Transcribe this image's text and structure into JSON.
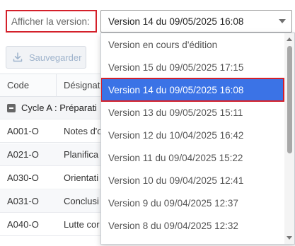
{
  "version_selector": {
    "label": "Afficher la version:",
    "selected_value": "Version 14 du 09/05/2025 16:08",
    "options": [
      "Version en cours d'édition",
      "Version 15 du 09/05/2025 17:15",
      "Version 14 du 09/05/2025 16:08",
      "Version 13 du 09/05/2025 15:11",
      "Version 12 du 10/04/2025 16:42",
      "Version 11 du 09/04/2025 15:22",
      "Version 10 du 09/04/2025 12:41",
      "Version 9 du 09/04/2025 12:37",
      "Version 8 du 09/04/2025 12:32"
    ]
  },
  "toolbar": {
    "save_label": "Sauvegarder"
  },
  "table": {
    "headers": {
      "code": "Code",
      "designation": "Désignat"
    },
    "group": {
      "label": "Cycle A : Préparati"
    },
    "rows": [
      {
        "code": "A001-O",
        "designation": "Notes d'o"
      },
      {
        "code": "A021-O",
        "designation": "Planifica"
      },
      {
        "code": "A030-O",
        "designation": "Orientati"
      },
      {
        "code": "A031-O",
        "designation": "Conclusi"
      },
      {
        "code": "A040-O",
        "designation": "Lutte cor"
      }
    ]
  },
  "colors": {
    "highlight_outline": "#d4202a",
    "selected_option_bg": "#3b73e6"
  }
}
